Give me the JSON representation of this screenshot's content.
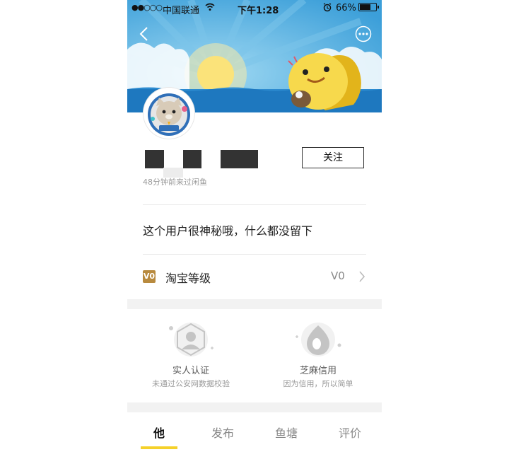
{
  "status_bar": {
    "signal": "●●○○○",
    "carrier": "中国联通",
    "wifi_icon": "wifi-icon",
    "time": "下午1:28",
    "alarm_icon": "alarm-icon",
    "battery_percent": "66%",
    "battery_level": 0.66
  },
  "header": {
    "back_icon": "back-arrow-icon",
    "more_icon": "more-icon"
  },
  "profile": {
    "follow_label": "关注",
    "last_visit": "48分钟前来过闲鱼",
    "bio": "这个用户很神秘哦，什么都没留下"
  },
  "level": {
    "icon_text": "V0",
    "label": "淘宝等级",
    "value": "V0"
  },
  "credit": {
    "items": [
      {
        "title": "实人认证",
        "subtitle": "未通过公安网数据校验",
        "icon": "person-verify-icon"
      },
      {
        "title": "芝麻信用",
        "subtitle": "因为信用，所以简单",
        "icon": "sesame-credit-icon"
      }
    ]
  },
  "tabs": {
    "items": [
      "他",
      "发布",
      "鱼塘",
      "评价"
    ],
    "active_index": 0
  },
  "colors": {
    "accent": "#f5d12a",
    "banner_sky": "#4aa8e0",
    "level_icon": "#b88a3e"
  }
}
